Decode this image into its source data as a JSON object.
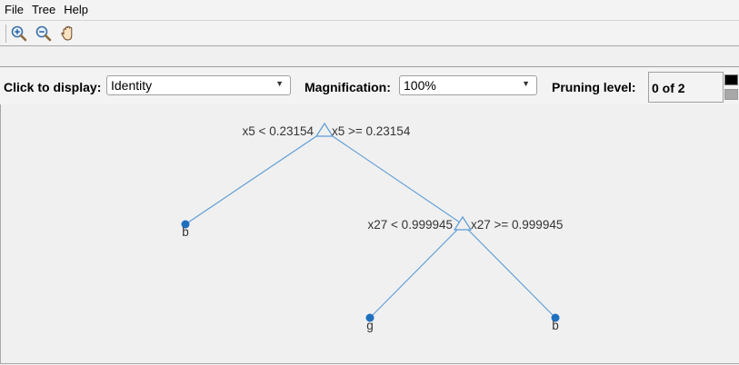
{
  "menu": [
    "File",
    "Tree",
    "Help"
  ],
  "toolbar": {
    "buttons": [
      "zoom-in-icon",
      "zoom-out-icon",
      "pan-hand-icon"
    ]
  },
  "controls": {
    "display_label": "Click to display:",
    "display_value": "Identity",
    "magnification_label": "Magnification:",
    "magnification_value": "100%",
    "pruning_label": "Pruning level:",
    "pruning_value": "0 of 2"
  },
  "tree": {
    "root": {
      "left_label": "x5 < 0.23154",
      "right_label": "x5 >= 0.23154"
    },
    "node2": {
      "left_label": "x27 < 0.999945",
      "right_label": "x27 >= 0.999945"
    },
    "leaves": [
      "b",
      "g",
      "b"
    ]
  },
  "colors": {
    "edge": "#5b9bd5",
    "leaf_fill": "#1f6fbf",
    "prune_on": "#000000",
    "prune_off": "#a8a8a8"
  }
}
